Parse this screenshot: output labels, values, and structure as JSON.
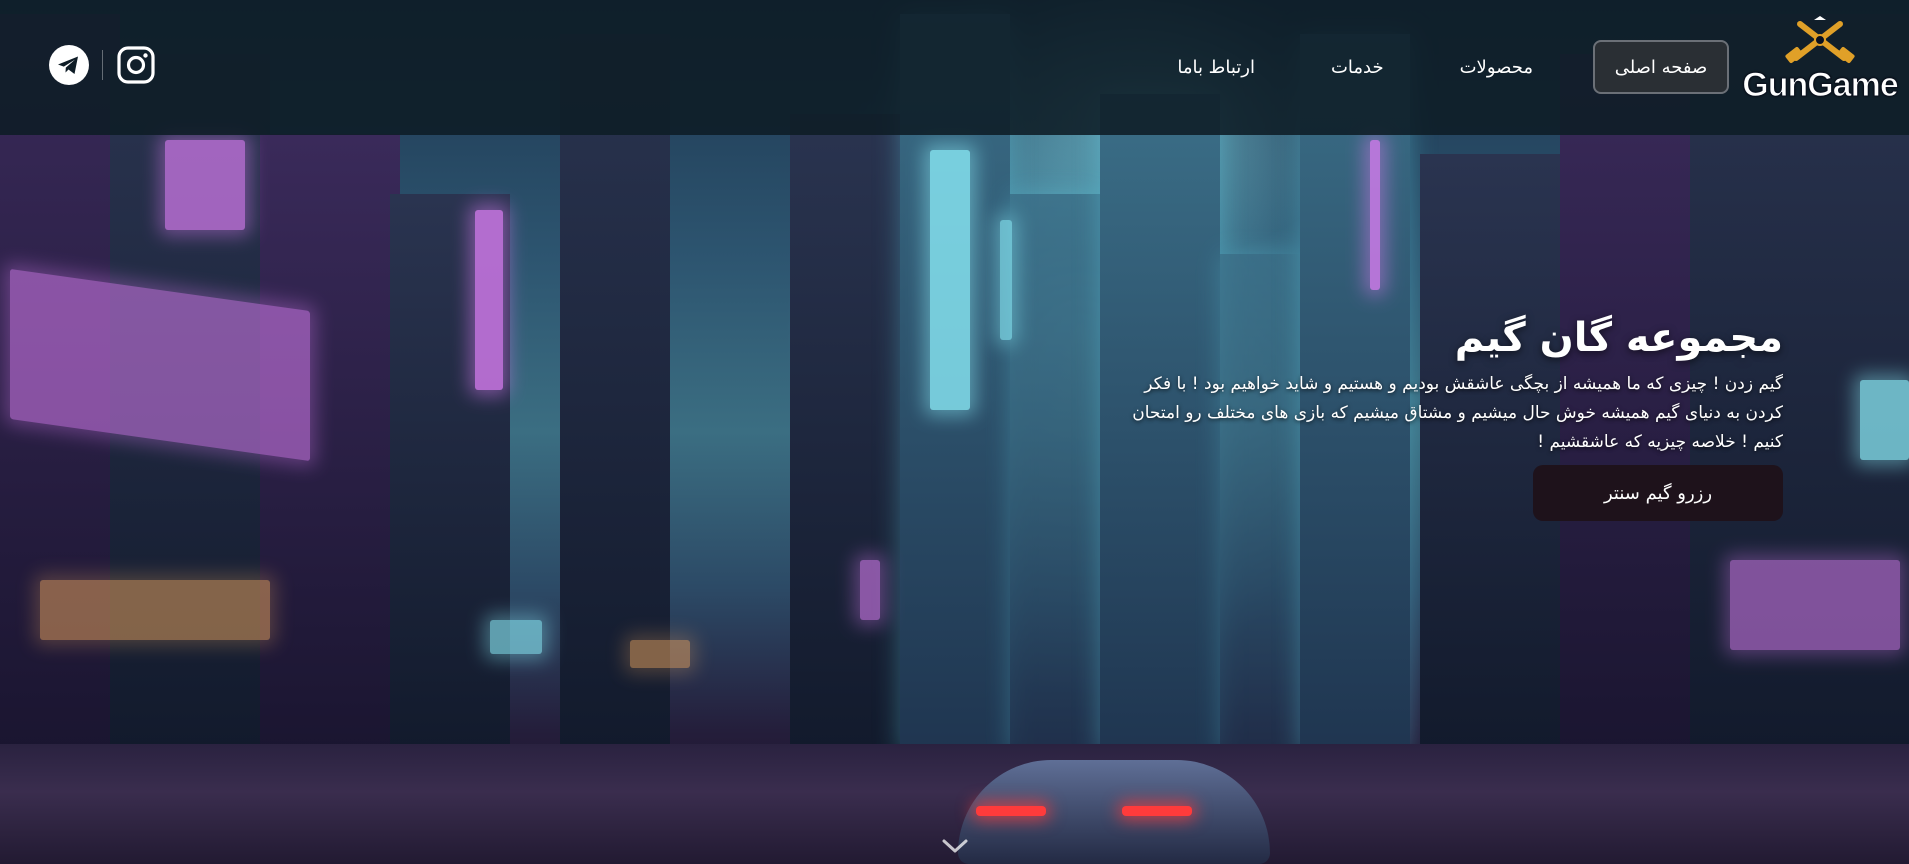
{
  "brand": {
    "logo_text": "GunGame",
    "accent_color": "#e0a028"
  },
  "nav": {
    "items": [
      {
        "label": "صفحه اصلی",
        "active": true
      },
      {
        "label": "محصولات",
        "active": false
      },
      {
        "label": "خدمات",
        "active": false
      },
      {
        "label": "ارتباط باما",
        "active": false
      }
    ]
  },
  "social": {
    "icons": [
      "instagram-icon",
      "telegram-icon"
    ]
  },
  "hero": {
    "title": "مجموعه گان گیم",
    "description_lines": [
      "گیم زدن ! چیزی که ما همیشه از بچگی عاشقش بودیم و هستیم و شاید خواهیم بود ! با فکر",
      "کردن به دنیای گیم همیشه خوش حال میشیم و مشتاق میشیم که بازی های مختلف رو امتحان",
      "کنیم ! خلاصه چیزیه که عاشقشیم !"
    ],
    "cta_label": "رزرو گیم سنتر"
  },
  "scroll_indicator": "chevron-down-icon"
}
